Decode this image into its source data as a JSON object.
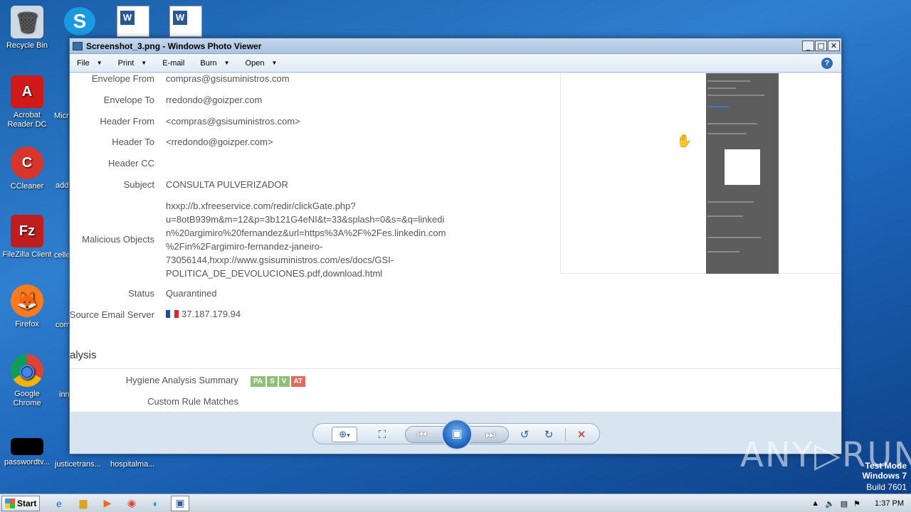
{
  "desktop": {
    "icons": [
      {
        "label": "Recycle Bin",
        "glyph": "🗑"
      },
      {
        "label": "Acrobat Reader DC",
        "glyph": "A"
      },
      {
        "label": "CCleaner",
        "glyph": "C"
      },
      {
        "label": "FileZilla Client",
        "glyph": "Fz"
      },
      {
        "label": "Firefox",
        "glyph": "🦊"
      },
      {
        "label": "Google Chrome",
        "glyph": "◉"
      },
      {
        "label": "passwordtv...",
        "glyph": ""
      }
    ],
    "partial_labels": [
      "Micr",
      "add",
      "celle",
      "com",
      "inn",
      "justicetrans...",
      "hospitalma..."
    ]
  },
  "window": {
    "title": "Screenshot_3.png - Windows Photo Viewer",
    "buttons": {
      "minimize": "_",
      "maximize": "□",
      "close": "✕"
    },
    "menu": [
      "File",
      "Print",
      "E-mail",
      "Burn",
      "Open"
    ],
    "help": "?"
  },
  "email": {
    "fields": [
      {
        "key": "Envelope From",
        "value": "compras@gsisuministros.com"
      },
      {
        "key": "Envelope To",
        "value": "rredondo@goizper.com"
      },
      {
        "key": "Header From",
        "value": "<compras@gsisuministros.com>"
      },
      {
        "key": "Header To",
        "value": "<rredondo@goizper.com>"
      },
      {
        "key": "Header CC",
        "value": ""
      },
      {
        "key": "Subject",
        "value": "CONSULTA PULVERIZADOR"
      }
    ],
    "malicious_key": "Malicious Objects",
    "malicious_value": "hxxp://b.xfreeservice.com/redir/clickGate.php?\nu=8otB939m&m=12&p=3b121G4eNI&t=33&splash=0&s=&q=linkedi\nn%20argimiro%20fernandez&url=https%3A%2F%2Fes.linkedin.com\n%2Fin%2Fargimiro-fernandez-janeiro-\n73056144,hxxp://www.gsisuministros.com/es/docs/GSI-\nPOLITICA_DE_DEVOLUCIONES.pdf,download.html",
    "status_key": "Status",
    "status_value": "Quarantined",
    "server_key": "Source Email Server",
    "server_value": "37.187.179.94",
    "section_title": "alysis",
    "hygiene_key": "Hygiene Analysis Summary",
    "badges": [
      {
        "label": "PA",
        "color": "#8fc07a"
      },
      {
        "label": "S",
        "color": "#8fc07a"
      },
      {
        "label": "V",
        "color": "#8fc07a"
      },
      {
        "label": "AT",
        "color": "#e06b61"
      }
    ],
    "custom_rule_key": "Custom Rule Matches"
  },
  "controls": {
    "zoom": "⊕",
    "zoom_caret": "▾",
    "actual_size": "⛶",
    "prev": "⏮",
    "slideshow": "▣",
    "next": "⏭",
    "rotate_ccw": "↺",
    "rotate_cw": "↻",
    "delete": "✕"
  },
  "taskbar": {
    "start": "Start",
    "time": "1:37 PM"
  },
  "watermark": {
    "line1": "Test Mode",
    "line2": "Windows 7",
    "line3": "Build 7601",
    "brand": "ANY▷RUN"
  }
}
